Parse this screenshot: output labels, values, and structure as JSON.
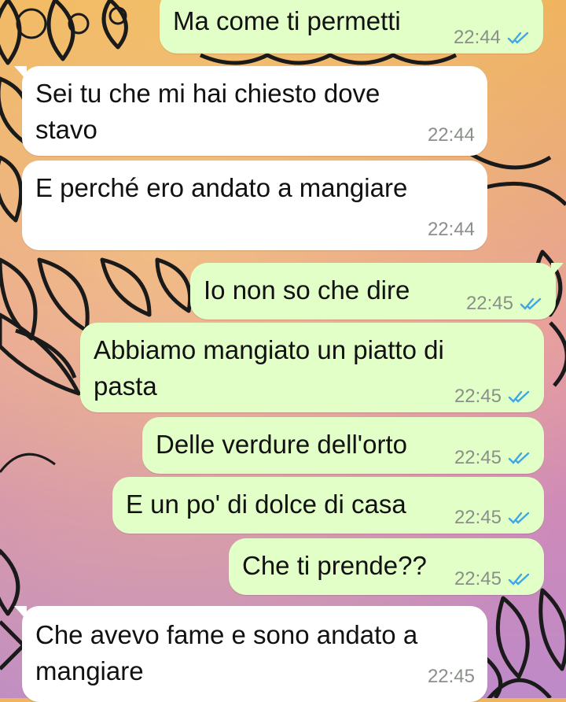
{
  "colors": {
    "outgoing_bubble": "#e2ffc7",
    "incoming_bubble": "#ffffff",
    "read_ticks": "#3fa7e3",
    "timestamp": "#8a8f8a"
  },
  "messages": [
    {
      "direction": "out",
      "text": "Ma come ti permetti",
      "time": "22:44",
      "status": "read"
    },
    {
      "direction": "in",
      "text": "Sei tu che mi hai chiesto dove\nstavo",
      "time": "22:44"
    },
    {
      "direction": "in",
      "text": "E perché ero andato a mangiare",
      "time": "22:44"
    },
    {
      "direction": "out",
      "text": "Io non so che dire",
      "time": "22:45",
      "status": "read"
    },
    {
      "direction": "out",
      "text": "Abbiamo mangiato un piatto di\npasta",
      "time": "22:45",
      "status": "read"
    },
    {
      "direction": "out",
      "text": "Delle verdure dell'orto",
      "time": "22:45",
      "status": "read"
    },
    {
      "direction": "out",
      "text": "E un po' di dolce di casa",
      "time": "22:45",
      "status": "read"
    },
    {
      "direction": "out",
      "text": "Che ti prende??",
      "time": "22:45",
      "status": "read"
    },
    {
      "direction": "in",
      "text": "Che avevo fame e sono andato a\nmangiare",
      "time": "22:45"
    }
  ]
}
